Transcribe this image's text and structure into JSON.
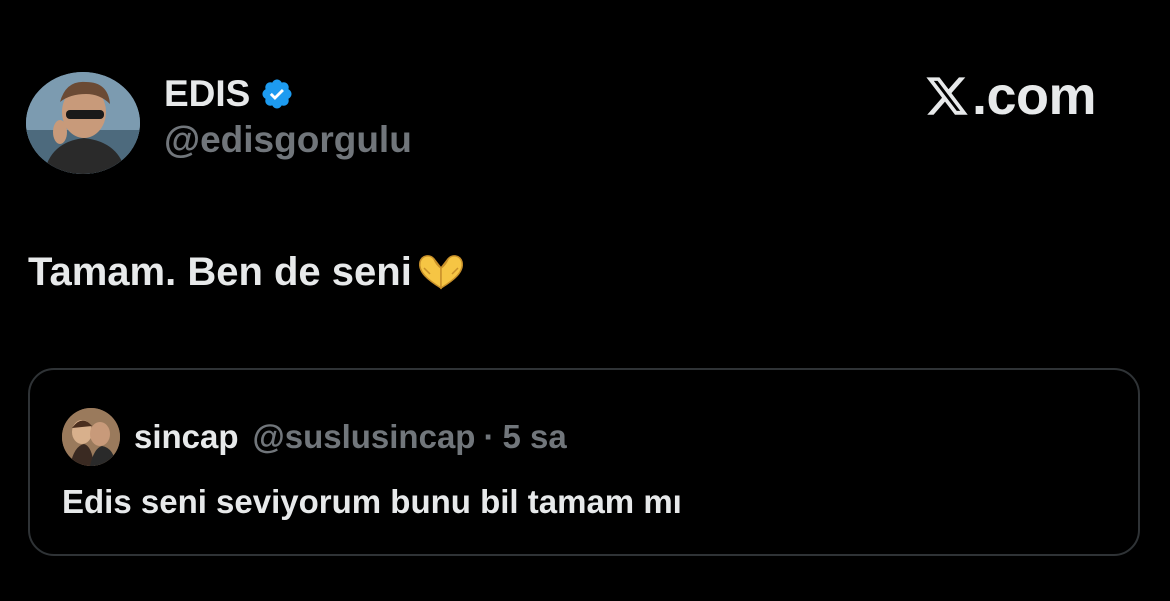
{
  "author": {
    "display_name": "EDIS",
    "handle": "@edisgorgulu",
    "verified": true,
    "avatar_icon": "profile-photo"
  },
  "brand": {
    "logo_icon": "x-logo-icon",
    "suffix": ".com"
  },
  "tweet": {
    "text": "Tamam. Ben de seni",
    "emoji_icon": "heart-hands-emoji"
  },
  "quoted": {
    "display_name": "sincap",
    "handle": "@suslusincap",
    "separator": "·",
    "time": "5 sa",
    "text": "Edis seni seviyorum bunu bil tamam mı",
    "avatar_icon": "profile-photo"
  },
  "colors": {
    "background": "#000000",
    "primary_text": "#e7e9ea",
    "secondary_text": "#71767b",
    "border": "#2f3336",
    "verified_blue": "#1d9bf0"
  }
}
